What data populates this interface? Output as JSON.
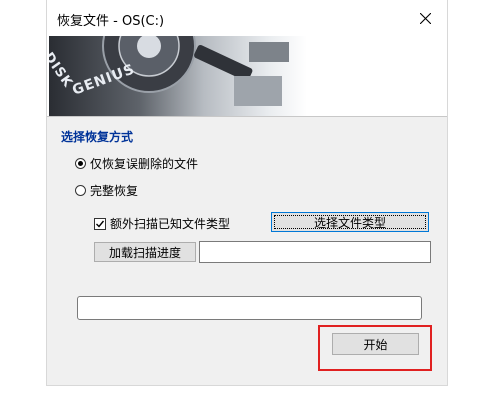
{
  "window": {
    "title": "恢复文件 - OS(C:)"
  },
  "banner": {
    "logo_line1": "DISK",
    "logo_line2": "GENIUS"
  },
  "section": {
    "title": "选择恢复方式"
  },
  "options": {
    "recover_deleted": {
      "label": "仅恢复误删除的文件",
      "checked": true
    },
    "full_recovery": {
      "label": "完整恢复",
      "checked": false
    },
    "extra_scan": {
      "label": "额外扫描已知文件类型",
      "checked": true
    }
  },
  "buttons": {
    "select_file_types": "选择文件类型",
    "load_progress": "加载扫描进度",
    "start": "开始"
  },
  "fields": {
    "progress_path_value": ""
  },
  "colors": {
    "section_title": "#003399",
    "highlight": "#e02020"
  }
}
